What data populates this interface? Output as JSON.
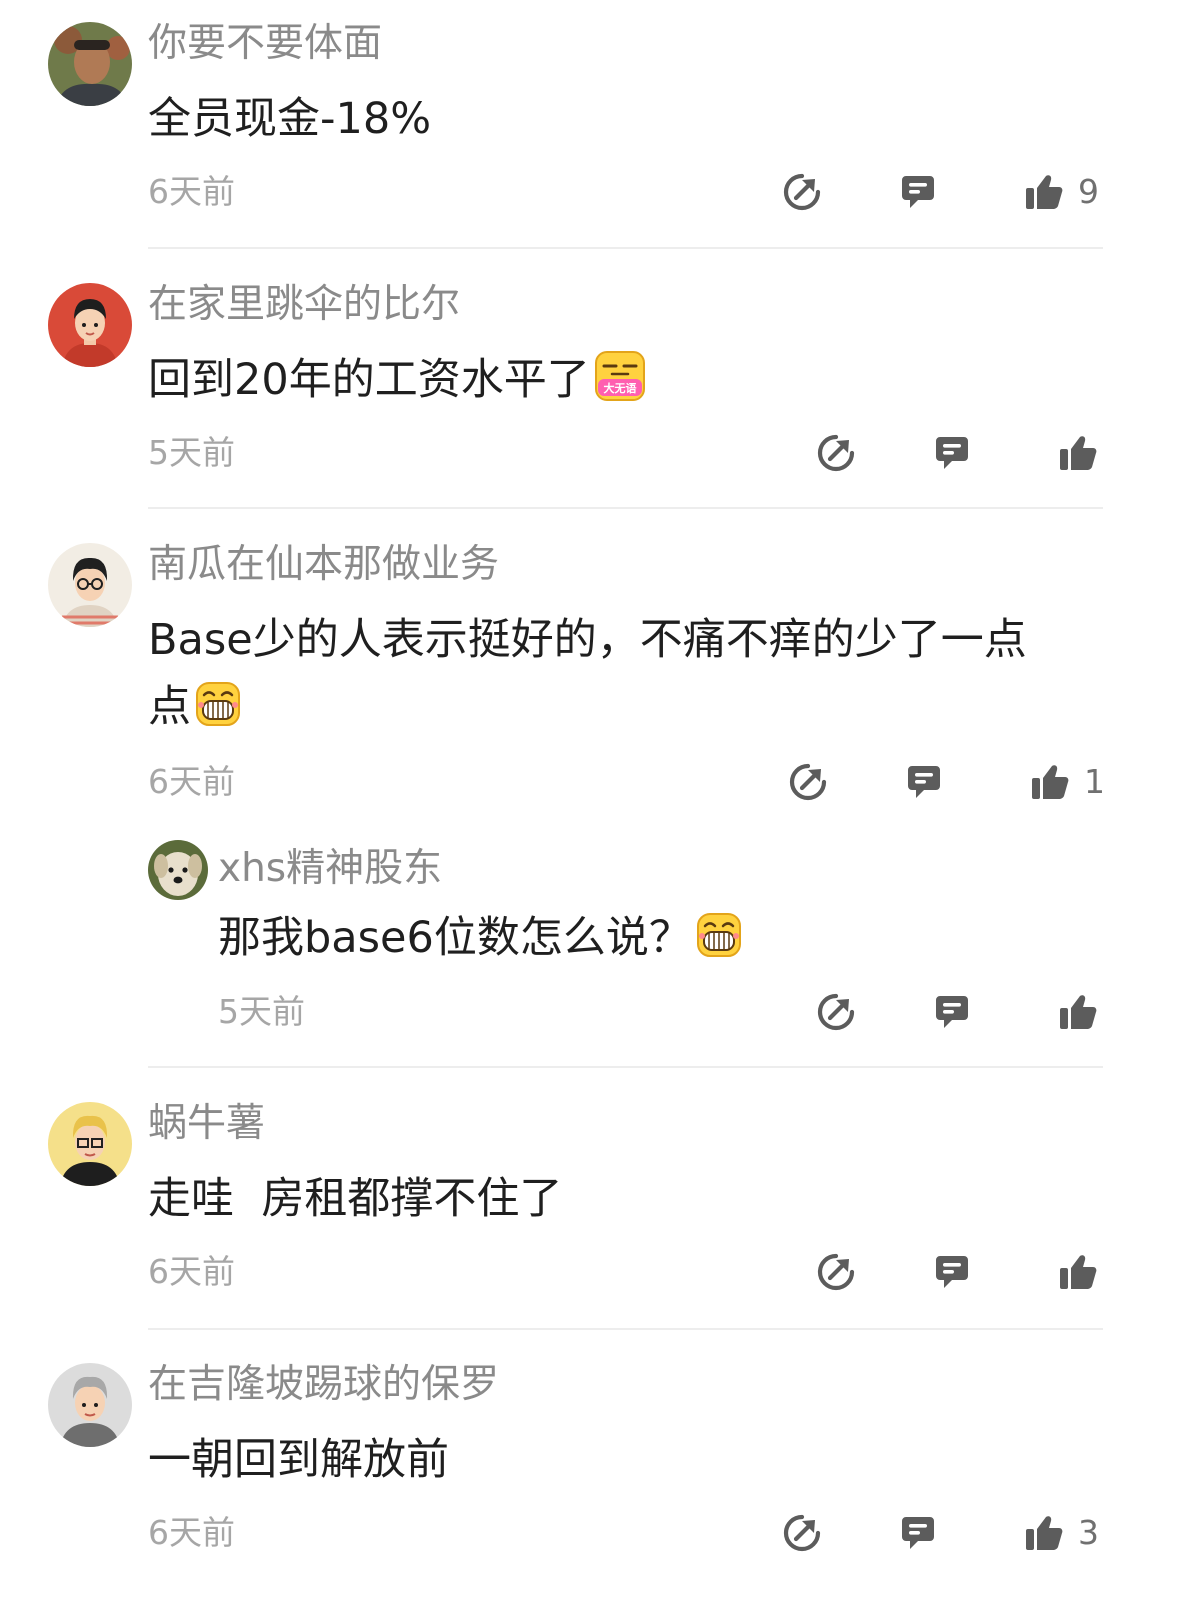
{
  "comments": [
    {
      "username": "你要不要体面",
      "text": "全员现金-18%",
      "time": "6天前",
      "likes": "9",
      "avatar": "photo-man-avatar"
    },
    {
      "username": "在家里跳伞的比尔",
      "text": "回到20年的工资水平了",
      "emoji_label": "大无语",
      "time": "5天前",
      "likes": "",
      "avatar": "cartoon-man-red-avatar"
    },
    {
      "username": "南瓜在仙本那做业务",
      "text_line1": "Base少的人表示挺好的，不痛不痒的少了一点",
      "text_line2": "点",
      "time": "6天前",
      "likes": "1",
      "avatar": "cartoon-man-glasses-avatar",
      "reply": {
        "username": "xhs精神股东",
        "text": "那我base6位数怎么说？",
        "time": "5天前",
        "likes": "",
        "avatar": "dog-avatar"
      }
    },
    {
      "username": "蜗牛薯",
      "text": "走哇  房租都撑不住了",
      "time": "6天前",
      "likes": "",
      "avatar": "cartoon-man-blond-avatar"
    },
    {
      "username": "在吉隆坡踢球的保罗",
      "text": "一朝回到解放前",
      "time": "6天前",
      "likes": "3",
      "avatar": "cartoon-man-gray-hair-avatar"
    }
  ],
  "icons": {
    "share": "share-icon",
    "reply": "reply-bubble-icon",
    "like": "thumbs-up-icon"
  },
  "colors": {
    "username": "#8a8a8a",
    "text": "#1f1f1f",
    "time": "#a6a6a6",
    "icon": "#5c5c5c",
    "divider": "#ededed"
  }
}
